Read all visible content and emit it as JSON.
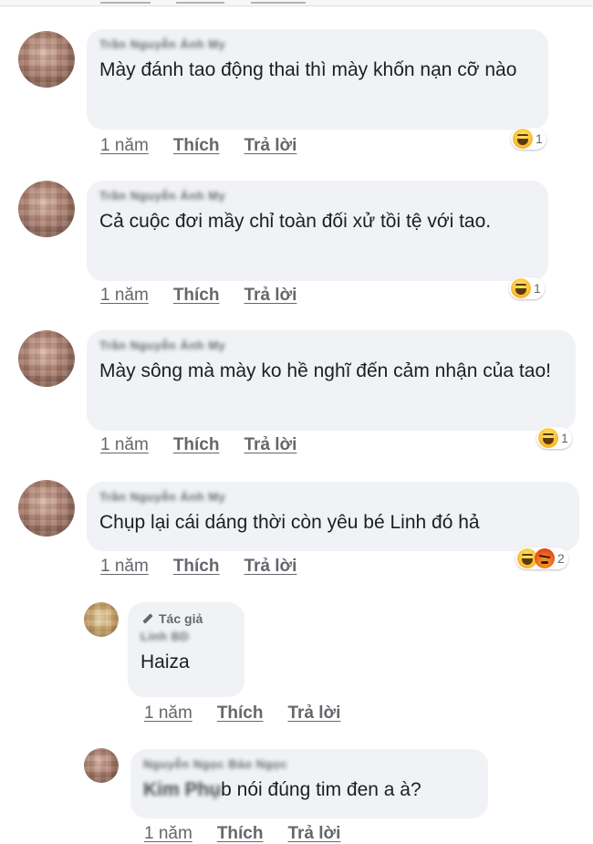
{
  "labels": {
    "like": "Thích",
    "reply": "Trả lời",
    "time": "1 năm",
    "author_badge": "Tác giả"
  },
  "comments": [
    {
      "name": "Trần Nguyễn Ánh My",
      "text": "Mày đánh tao động thai thì mày khốn nạn cỡ nào",
      "reactions": [
        "haha-icon"
      ],
      "reaction_count": "1"
    },
    {
      "name": "Trần Nguyễn Ánh My",
      "text": "Cả cuộc đơi mầy chỉ toàn đối xử tồi tệ với tao.",
      "reactions": [
        "haha-icon"
      ],
      "reaction_count": "1"
    },
    {
      "name": "Trần Nguyễn Ánh My",
      "text": "Mày sông mà mày ko hề nghĩ đến cảm nhận của tao!",
      "reactions": [
        "haha-icon"
      ],
      "reaction_count": "1"
    },
    {
      "name": "Trần Nguyễn Ánh My",
      "text": "Chụp lại cái dáng thời còn yêu bé Linh đó hả",
      "reactions": [
        "haha-icon",
        "angry-icon"
      ],
      "reaction_count": "2"
    }
  ],
  "replies": [
    {
      "name": "Linh BD",
      "text": "Haiza"
    },
    {
      "name": "Nguyễn Ngọc Bảo Ngọc",
      "mention": "Kim Phụ",
      "text": "b nói đúng tim đen a à?"
    }
  ],
  "colors": {
    "bubble": "#f0f2f5",
    "meta": "#65676b",
    "text": "#1c1e21"
  }
}
